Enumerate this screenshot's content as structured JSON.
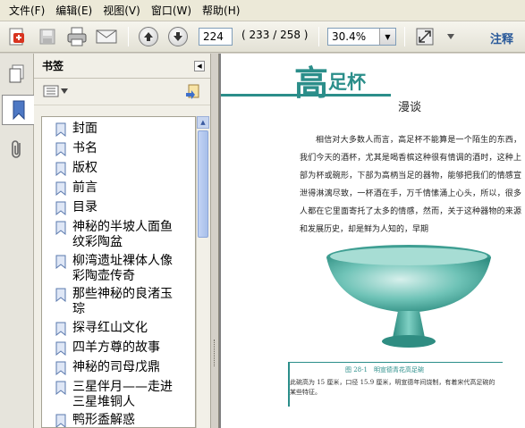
{
  "menubar": {
    "items": [
      "文件(F)",
      "编辑(E)",
      "视图(V)",
      "窗口(W)",
      "帮助(H)"
    ]
  },
  "toolbar": {
    "page_current": "224",
    "page_count": "( 233 / 258 )",
    "zoom": "30.4%",
    "annotation_label": "注释"
  },
  "bookmarks": {
    "header": "书签",
    "items": [
      "封面",
      "书名",
      "版权",
      "前言",
      "目录",
      "神秘的半坡人面鱼纹彩陶盆",
      "柳湾遗址裸体人像彩陶壶传奇",
      "那些神秘的良渚玉琮",
      "探寻红山文化",
      "四羊方尊的故事",
      "神秘的司母戊鼎",
      "三星伴月——走进三星堆铜人",
      "鸭形盉解惑"
    ]
  },
  "document": {
    "big_char": "高",
    "title_rest": "足杯",
    "subtitle": "漫谈",
    "paragraph": "相信对大多数人而言，高足杯不能算是一个陌生的东西，我们今天的酒杯，尤其是喝香槟这种很有情调的酒时，这种上部为杯或碗形，下部为高柄当足的器物，能够把我们的情感宣泄得淋漓尽致，一杯酒在手，万千情愫涌上心头，所以，很多人都在它里面寄托了太多的情感，然而，关于这种器物的来源和发展历史，却是鲜为人知的，早期",
    "caption_title": "图 28-1　明宣德青花高足碗",
    "caption_text": "此碗高为 15 厘米，口径 15.9 厘米，明宣德年间烧制，有着宋代高足碗的某些特征。"
  },
  "colors": {
    "accent": "#2b8e8a",
    "bowl": "#5fb9ad"
  }
}
